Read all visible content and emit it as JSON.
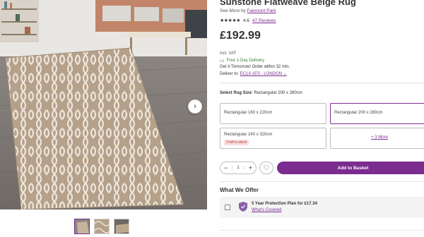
{
  "product": {
    "title": "Sunstone Flatweave Beige Rug",
    "see_more_prefix": "See More by",
    "brand": "Fairmont Park",
    "rating_value": "4.6",
    "stars": "★★★★★",
    "reviews_label": "47 Reviews",
    "price": "£192.99",
    "vat_label": "Incl. VAT"
  },
  "delivery": {
    "free_label": "Free 1-Day Delivery",
    "get_it": "Get it Tomorrow! Order within 32 min.",
    "deliver_to_prefix": "Deliver to:",
    "location": "EC1A 1ES - LONDON"
  },
  "size": {
    "select_label": "Select Rug Size:",
    "selected_value": "Rectangular 200 x 280cm",
    "options": [
      {
        "label": "Rectangular 160 x 220cm"
      },
      {
        "label": "Rectangular 200 x 280cm"
      },
      {
        "label": "Rectangular 240 x 320cm",
        "badge": "2 left in stock"
      },
      {
        "label": "+ 3 More"
      }
    ]
  },
  "cart": {
    "minus": "−",
    "quantity": "1",
    "plus": "+",
    "wishlist_icon": "♡",
    "add_label": "Add to Basket"
  },
  "offer": {
    "title": "What We Offer",
    "plan_text": "5 Year Protection Plan for £17.34",
    "link": "What's Covered"
  },
  "gallery": {
    "next_icon": "›",
    "thumb_count": 3,
    "active_thumb": 1
  },
  "colors": {
    "accent": "#7b2c8f",
    "rug_base": "#b5a089",
    "rug_pattern": "#ece6dc"
  }
}
